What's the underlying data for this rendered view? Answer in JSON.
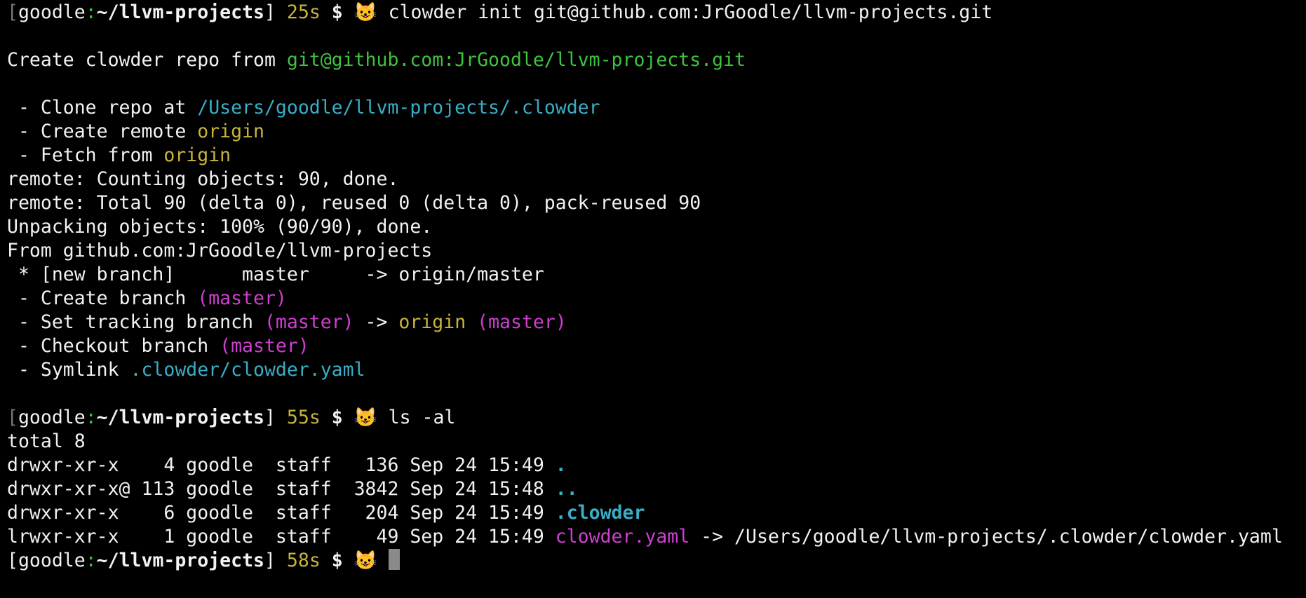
{
  "colors": {
    "background": "#000000",
    "text": "#f2f2f2",
    "green": "#3fc23f",
    "yellow": "#c8b43b",
    "cyan": "#3aaec7",
    "magenta": "#cf3fcf",
    "cursor": "#8a8a8a"
  },
  "lines": [
    [
      {
        "t": "[",
        "c": "#777777"
      },
      {
        "t": "goodle",
        "c": "#f2f2f2"
      },
      {
        "t": ":",
        "c": "#3fc23f"
      },
      {
        "t": "~/llvm-projects",
        "c": "#f2f2f2",
        "b": true
      },
      {
        "t": "] ",
        "c": "#f2f2f2"
      },
      {
        "t": "25s",
        "c": "#c8b43b"
      },
      {
        "t": " ",
        "c": "#f2f2f2"
      },
      {
        "t": "$",
        "c": "#f2f2f2",
        "b": true
      },
      {
        "t": " 😺 ",
        "c": "#f2f2f2"
      },
      {
        "t": "clowder init git@github.com:JrGoodle/llvm-projects.git",
        "c": "#f2f2f2"
      }
    ],
    [],
    [
      {
        "t": "Create clowder repo from ",
        "c": "#f2f2f2"
      },
      {
        "t": "git@github.com:JrGoodle/llvm-projects.git",
        "c": "#3fc23f"
      }
    ],
    [],
    [
      {
        "t": " - Clone repo at ",
        "c": "#f2f2f2"
      },
      {
        "t": "/Users/goodle/llvm-projects/.clowder",
        "c": "#3aaec7"
      }
    ],
    [
      {
        "t": " - Create remote ",
        "c": "#f2f2f2"
      },
      {
        "t": "origin",
        "c": "#c8b43b"
      }
    ],
    [
      {
        "t": " - Fetch from ",
        "c": "#f2f2f2"
      },
      {
        "t": "origin",
        "c": "#c8b43b"
      }
    ],
    [
      {
        "t": "remote: Counting objects: 90, done.",
        "c": "#f2f2f2"
      }
    ],
    [
      {
        "t": "remote: Total 90 (delta 0), reused 0 (delta 0), pack-reused 90",
        "c": "#f2f2f2"
      }
    ],
    [
      {
        "t": "Unpacking objects: 100% (90/90), done.",
        "c": "#f2f2f2"
      }
    ],
    [
      {
        "t": "From github.com:JrGoodle/llvm-projects",
        "c": "#f2f2f2"
      }
    ],
    [
      {
        "t": " * [new branch]      master     -> origin/master",
        "c": "#f2f2f2"
      }
    ],
    [
      {
        "t": " - Create branch ",
        "c": "#f2f2f2"
      },
      {
        "t": "(master)",
        "c": "#cf3fcf"
      }
    ],
    [
      {
        "t": " - Set tracking branch ",
        "c": "#f2f2f2"
      },
      {
        "t": "(master)",
        "c": "#cf3fcf"
      },
      {
        "t": " -> ",
        "c": "#f2f2f2"
      },
      {
        "t": "origin",
        "c": "#c8b43b"
      },
      {
        "t": " ",
        "c": "#f2f2f2"
      },
      {
        "t": "(master)",
        "c": "#cf3fcf"
      }
    ],
    [
      {
        "t": " - Checkout branch ",
        "c": "#f2f2f2"
      },
      {
        "t": "(master)",
        "c": "#cf3fcf"
      }
    ],
    [
      {
        "t": " - Symlink ",
        "c": "#f2f2f2"
      },
      {
        "t": ".clowder/clowder.yaml",
        "c": "#3aaec7"
      }
    ],
    [],
    [
      {
        "t": "[",
        "c": "#777777"
      },
      {
        "t": "goodle",
        "c": "#f2f2f2"
      },
      {
        "t": ":",
        "c": "#3fc23f"
      },
      {
        "t": "~/llvm-projects",
        "c": "#f2f2f2",
        "b": true
      },
      {
        "t": "] ",
        "c": "#f2f2f2"
      },
      {
        "t": "55s",
        "c": "#c8b43b"
      },
      {
        "t": " ",
        "c": "#f2f2f2"
      },
      {
        "t": "$",
        "c": "#f2f2f2",
        "b": true
      },
      {
        "t": " 😺 ",
        "c": "#f2f2f2"
      },
      {
        "t": "ls -al",
        "c": "#f2f2f2"
      }
    ],
    [
      {
        "t": "total 8",
        "c": "#f2f2f2"
      }
    ],
    [
      {
        "t": "drwxr-xr-x    4 goodle  staff   136 Sep 24 15:49 ",
        "c": "#f2f2f2"
      },
      {
        "t": ".",
        "c": "#3aaec7",
        "b": true
      }
    ],
    [
      {
        "t": "drwxr-xr-x@ 113 goodle  staff  3842 Sep 24 15:48 ",
        "c": "#f2f2f2"
      },
      {
        "t": "..",
        "c": "#3aaec7",
        "b": true
      }
    ],
    [
      {
        "t": "drwxr-xr-x    6 goodle  staff   204 Sep 24 15:49 ",
        "c": "#f2f2f2"
      },
      {
        "t": ".clowder",
        "c": "#3aaec7",
        "b": true
      }
    ],
    [
      {
        "t": "lrwxr-xr-x    1 goodle  staff    49 Sep 24 15:49 ",
        "c": "#f2f2f2"
      },
      {
        "t": "clowder.yaml",
        "c": "#cf3fcf"
      },
      {
        "t": " -> /Users/goodle/llvm-projects/.clowder/clowder.yaml",
        "c": "#f2f2f2"
      }
    ],
    [
      {
        "t": "[",
        "c": "#f2f2f2"
      },
      {
        "t": "goodle",
        "c": "#f2f2f2"
      },
      {
        "t": ":",
        "c": "#3fc23f"
      },
      {
        "t": "~/llvm-projects",
        "c": "#f2f2f2",
        "b": true
      },
      {
        "t": "] ",
        "c": "#f2f2f2"
      },
      {
        "t": "58s",
        "c": "#c8b43b"
      },
      {
        "t": " ",
        "c": "#f2f2f2"
      },
      {
        "t": "$",
        "c": "#f2f2f2",
        "b": true
      },
      {
        "t": " 😺 ",
        "c": "#f2f2f2"
      },
      {
        "cursor": true
      }
    ]
  ]
}
